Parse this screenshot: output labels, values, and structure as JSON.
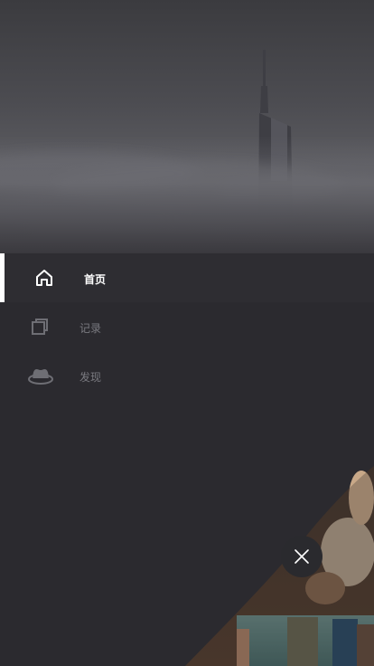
{
  "menu": {
    "items": [
      {
        "label": "首页",
        "icon": "home-icon",
        "active": true
      },
      {
        "label": "记录",
        "icon": "records-icon",
        "active": false
      },
      {
        "label": "发现",
        "icon": "hat-icon",
        "active": false
      }
    ]
  },
  "close_button": {
    "icon": "close-icon"
  },
  "colors": {
    "background": "#2b2a2f",
    "active_text": "#ffffff",
    "inactive_text": "#7a7a80",
    "active_indicator": "#ffffff"
  }
}
